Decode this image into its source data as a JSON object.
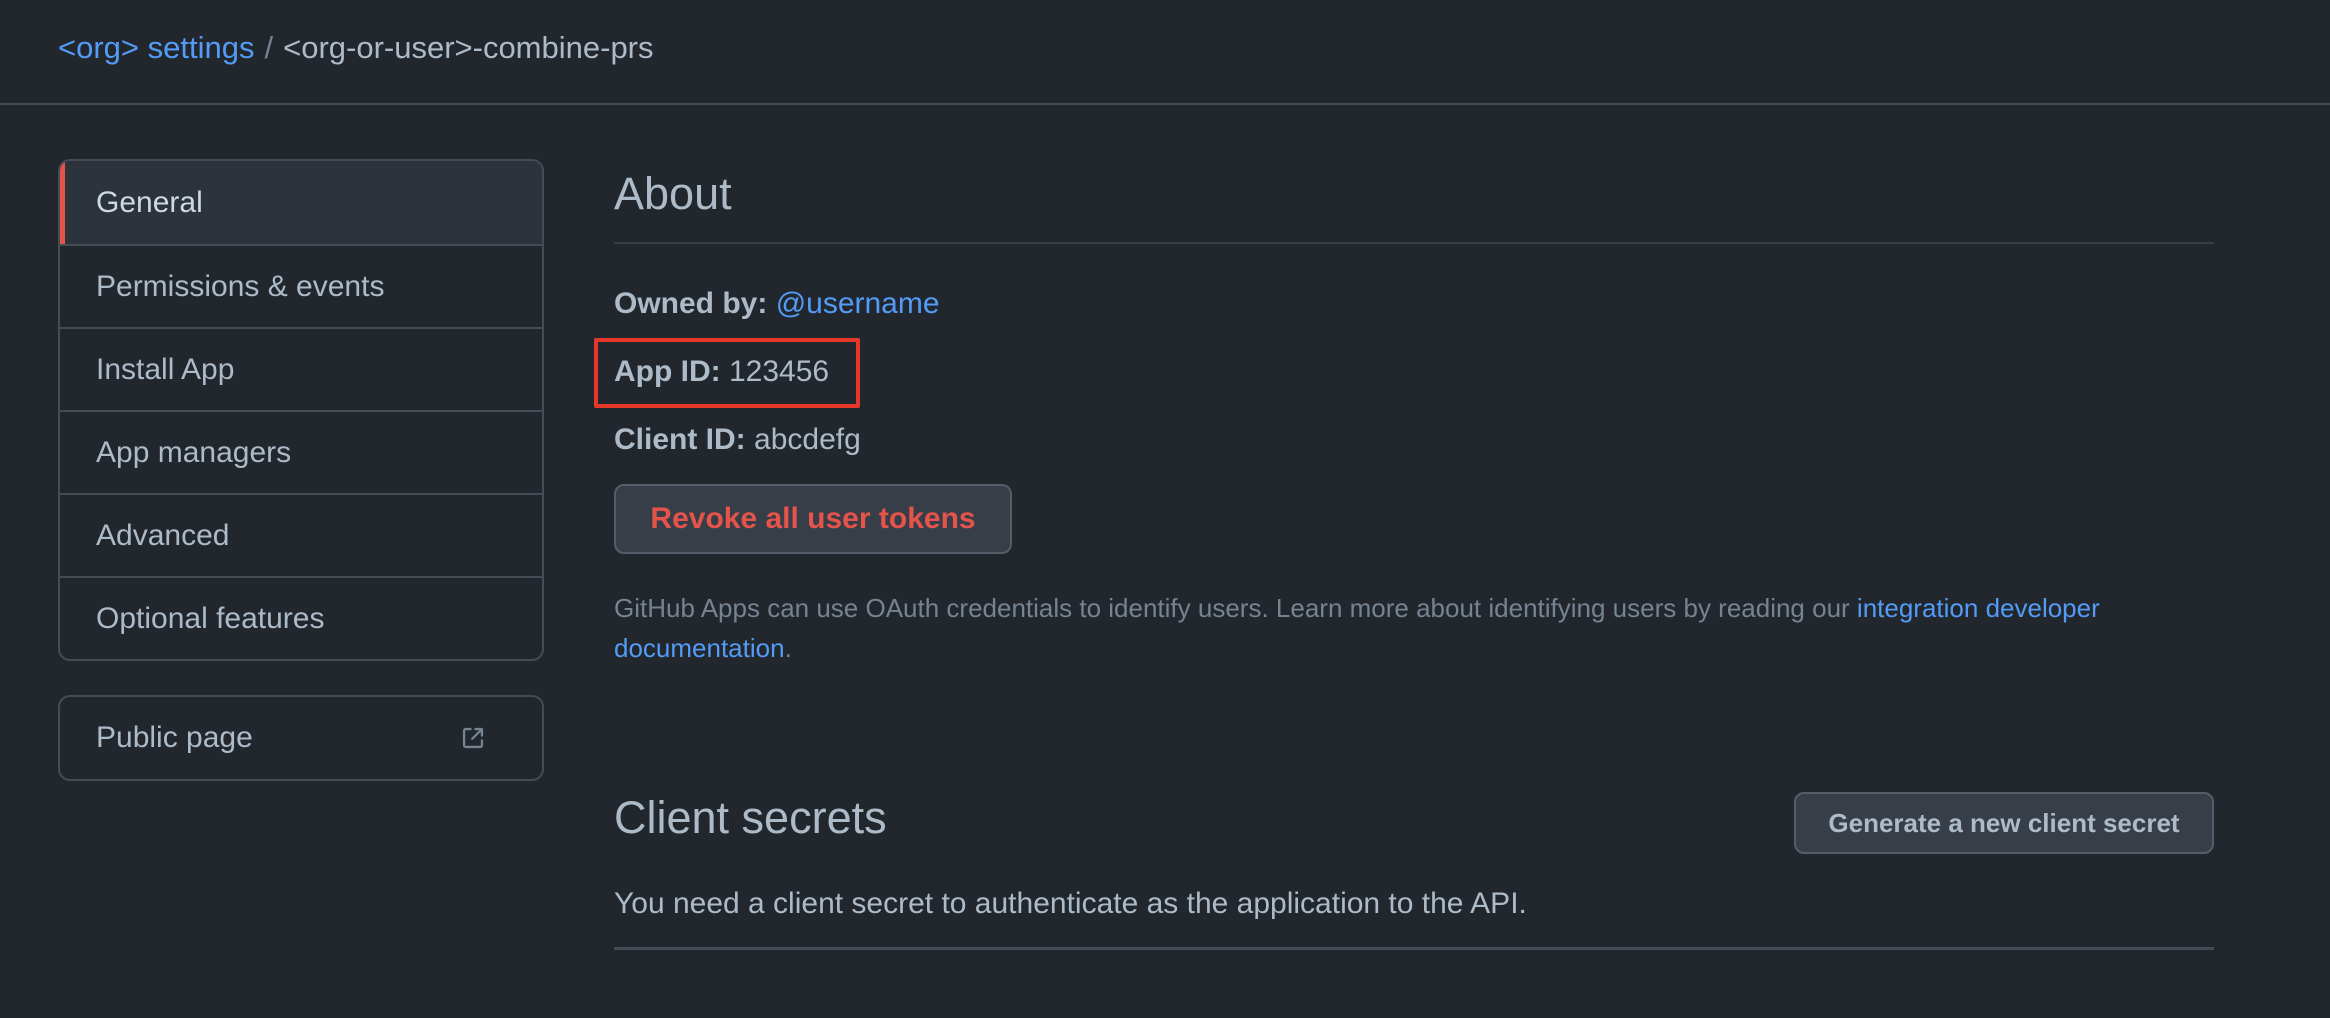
{
  "breadcrumb": {
    "parent": "<org> settings",
    "separator": "/",
    "current": "<org-or-user>-combine-prs"
  },
  "sidebar": {
    "items": [
      {
        "label": "General",
        "selected": true
      },
      {
        "label": "Permissions & events",
        "selected": false
      },
      {
        "label": "Install App",
        "selected": false
      },
      {
        "label": "App managers",
        "selected": false
      },
      {
        "label": "Advanced",
        "selected": false
      },
      {
        "label": "Optional features",
        "selected": false
      }
    ],
    "public_page": {
      "label": "Public page",
      "icon": "external-link-icon"
    }
  },
  "about": {
    "heading": "About",
    "owned_by_label": "Owned by:",
    "owned_by_value": "@username",
    "app_id_label": "App ID:",
    "app_id_value": "123456",
    "client_id_label": "Client ID:",
    "client_id_value": "abcdefg",
    "revoke_button": "Revoke all user tokens",
    "help_text": "GitHub Apps can use OAuth credentials to identify users. Learn more about identifying users by reading our ",
    "help_link": "integration developer documentation",
    "help_suffix": "."
  },
  "client_secrets": {
    "heading": "Client secrets",
    "generate_button": "Generate a new client secret",
    "description": "You need a client secret to authenticate as the application to the API."
  },
  "colors": {
    "background": "#22272e",
    "accent_link": "#539bf5",
    "danger": "#e5534b",
    "highlight_box": "#e5382a"
  }
}
